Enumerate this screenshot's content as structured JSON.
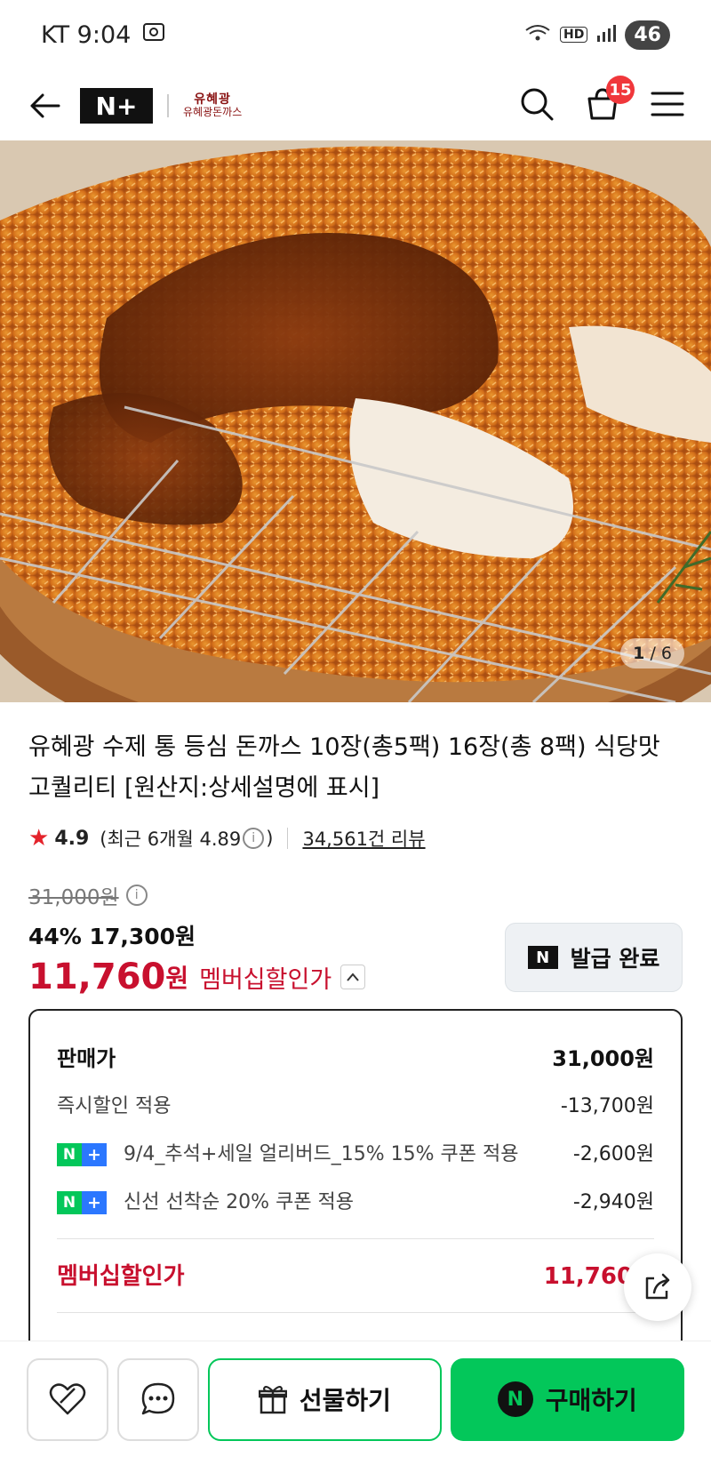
{
  "status": {
    "carrier_time": "KT 9:04",
    "battery": "46",
    "hd": "HD"
  },
  "header": {
    "brand_logo_text": "N+",
    "store_logo_mark": "유혜광",
    "store_logo_text": "유혜광돈까스",
    "cart_count": "15"
  },
  "gallery": {
    "current": "1",
    "separator": "/",
    "total": "6"
  },
  "product": {
    "title": "유혜광 수제 통 등심 돈까스 10장(총5팩) 16장(총 8팩) 식당맛 고퀄리티 [원산지:상세설명에 표시]",
    "rating": "4.9",
    "recent_rating": "(최근 6개월 4.89",
    "recent_rating_close": ")",
    "review_count": "34,561건 리뷰"
  },
  "price": {
    "original": "31,000원",
    "sale": "44% 17,300원",
    "member_price": "11,760",
    "member_price_unit": "원",
    "member_label": "멤버십할인가",
    "coupon_button": "발급 완료"
  },
  "breakdown": {
    "rows": [
      {
        "label": "판매가",
        "amount": "31,000원"
      },
      {
        "label": "즉시할인 적용",
        "amount": "-13,700원"
      },
      {
        "label": "9/4_추석+세일 얼리버드_15% 15% 쿠폰 적용",
        "amount": "-2,600원"
      },
      {
        "label": "신선 선착순 20% 쿠폰 적용",
        "amount": "-2,940원"
      }
    ],
    "member_label": "멤버십할인가",
    "member_amount": "11,760원"
  },
  "bottom": {
    "gift_label": "선물하기",
    "buy_label": "구매하기"
  },
  "colors": {
    "accent_red": "#c8102e",
    "naver_green": "#03c75a",
    "plus_blue": "#2b77ff",
    "badge_red": "#f0373b"
  }
}
